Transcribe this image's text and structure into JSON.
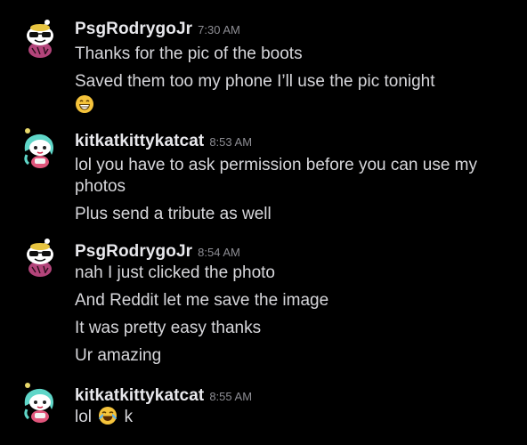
{
  "colors": {
    "background": "#000000",
    "username": "#e8e8ec",
    "timestamp": "#8d8d93",
    "message": "#d7d7db"
  },
  "messages": [
    {
      "author": "PsgRodrygoJr",
      "time": "7:30 AM",
      "avatar": "snoo-sunglasses-pink-avatar",
      "lines": [
        "Thanks for the pic of the boots",
        "Saved them too my phone I’ll use the pic tonight"
      ],
      "trailing_emoji": "grinning-face-emoji"
    },
    {
      "author": "kitkatkittykatcat",
      "time": "8:53 AM",
      "avatar": "snoo-teal-hair-avatar",
      "lines": [
        "lol you have to ask permission before you can use my photos",
        "Plus send a tribute as well"
      ]
    },
    {
      "author": "PsgRodrygoJr",
      "time": "8:54 AM",
      "avatar": "snoo-sunglasses-pink-avatar",
      "lines": [
        "nah I just clicked the photo",
        "And Reddit let me save the image",
        "It was pretty easy thanks",
        "Ur amazing"
      ]
    },
    {
      "author": "kitkatkittykatcat",
      "time": "8:55 AM",
      "avatar": "snoo-teal-hair-avatar",
      "last_line": {
        "before": "lol",
        "emoji": "face-with-tears-of-joy-emoji",
        "after": "k"
      }
    }
  ]
}
